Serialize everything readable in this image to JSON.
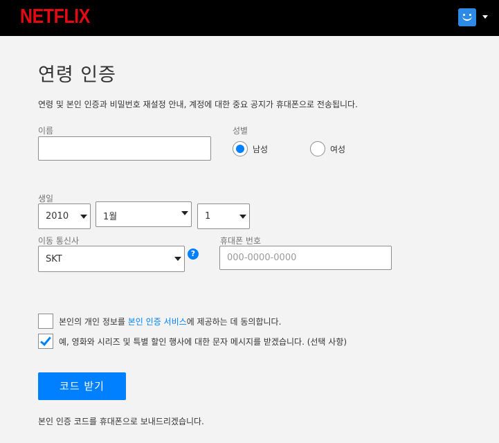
{
  "header": {
    "logo": "NETFLIX",
    "avatar_icon": "profile-smile-icon",
    "menu_icon": "caret-down-icon"
  },
  "page": {
    "title": "연령 인증",
    "description": "연령 및 본인 인증과 비밀번호 재설정 안내, 계정에 대한 중요 공지가 휴대폰으로 전송됩니다."
  },
  "form": {
    "name_label": "이름",
    "name_value": "",
    "gender_label": "성별",
    "gender_options": [
      {
        "label": "남성",
        "selected": true
      },
      {
        "label": "여성",
        "selected": false
      }
    ],
    "birth_label": "생일",
    "birth_year": "2010",
    "birth_month": "1월",
    "birth_day": "1",
    "carrier_label": "이동 통신사",
    "carrier_value": "SKT",
    "help_icon": "?",
    "phone_label": "휴대폰 번호",
    "phone_placeholder": "000-0000-0000",
    "consent_1": {
      "checked": false,
      "prefix": "본인의 개인 정보를 ",
      "link": "본인 인증 서비스",
      "suffix": "에 제공하는 데 동의합니다."
    },
    "consent_2": {
      "checked": true,
      "text": "예, 영화와 시리즈 및 특별 할인 행사에 대한 문자 메시지를 받겠습니다. (선택 사항)"
    },
    "submit_label": "코드 받기",
    "footer_note": "본인 인증 코드를 휴대폰으로 보내드리겠습니다."
  },
  "colors": {
    "brand": "#e50914",
    "accent": "#0080ff",
    "header_bg": "#000000",
    "page_bg": "#f3f3f3"
  }
}
